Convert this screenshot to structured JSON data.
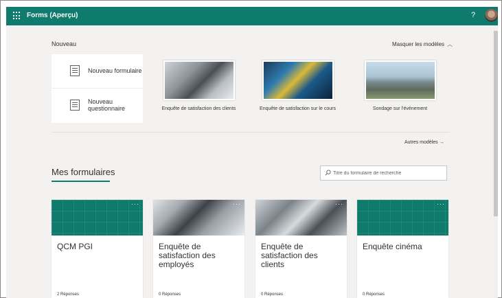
{
  "header": {
    "app_title": "Forms (Aperçu)",
    "help": "?"
  },
  "new_section": {
    "label": "Nouveau",
    "hide_templates": "Masquer les modèles",
    "new_form": "Nouveau formulaire",
    "new_quiz": "Nouveau questionnaire",
    "templates": [
      {
        "label": "Enquête de satisfaction des clients"
      },
      {
        "label": "Enquête de satisfaction sur le cours"
      },
      {
        "label": "Sondage sur l'événement"
      }
    ],
    "other_templates": "Autres modèles"
  },
  "my_forms": {
    "title": "Mes formulaires",
    "search_placeholder": "Titre du formulaire de recherche",
    "cards": [
      {
        "title": "QCM PGI",
        "responses": "2 Réponses"
      },
      {
        "title": "Enquête de satisfaction des employés",
        "responses": "0 Réponses"
      },
      {
        "title": "Enquête de satisfaction des clients",
        "responses": "0 Réponses"
      },
      {
        "title": "Enquête cinéma",
        "responses": "0 Réponses"
      }
    ]
  },
  "colors": {
    "brand": "#0f7b6c",
    "background": "#f3f2f1"
  }
}
